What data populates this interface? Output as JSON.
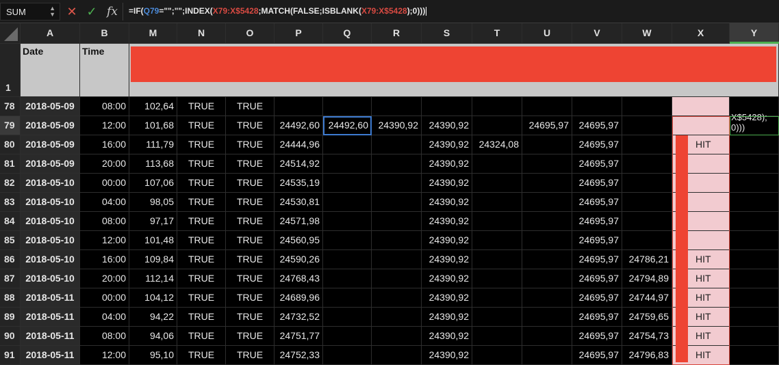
{
  "formula_bar": {
    "name_box": "SUM",
    "cancel_icon": "x-icon",
    "enter_icon": "checkmark-icon",
    "fx_label": "fx",
    "formula_parts": [
      {
        "t": "=IF(",
        "c": ""
      },
      {
        "t": "Q79",
        "c": "blue"
      },
      {
        "t": "=\"\";\"\";INDEX(",
        "c": ""
      },
      {
        "t": "X79:X$5428",
        "c": "red"
      },
      {
        "t": ";MATCH(FALSE;ISBLANK(",
        "c": ""
      },
      {
        "t": "X79:X$5428",
        "c": "red"
      },
      {
        "t": ");0)))",
        "c": ""
      }
    ]
  },
  "columns": [
    "A",
    "B",
    "M",
    "N",
    "O",
    "P",
    "Q",
    "R",
    "S",
    "T",
    "U",
    "V",
    "W",
    "X",
    "Y"
  ],
  "header_row": {
    "row_label": "1",
    "date_label": "Date",
    "time_label": "Time",
    "redacted_color": "#ee4433"
  },
  "rows": [
    {
      "r": "78",
      "date": "2018-05-09",
      "time": "08:00",
      "m": "102,64",
      "n": "TRUE",
      "o": "TRUE",
      "p": "",
      "q": "",
      "rr": "",
      "s": "",
      "t": "",
      "u": "",
      "v": "",
      "w": "",
      "x": ""
    },
    {
      "r": "79",
      "date": "2018-05-09",
      "time": "12:00",
      "m": "101,68",
      "n": "TRUE",
      "o": "TRUE",
      "p": "24492,60",
      "q": "24492,60",
      "rr": "24390,92",
      "s": "24390,92",
      "t": "",
      "u": "24695,97",
      "v": "24695,97",
      "w": "",
      "x": ""
    },
    {
      "r": "80",
      "date": "2018-05-09",
      "time": "16:00",
      "m": "111,79",
      "n": "TRUE",
      "o": "TRUE",
      "p": "24444,96",
      "q": "",
      "rr": "",
      "s": "24390,92",
      "t": "24324,08",
      "u": "",
      "v": "24695,97",
      "w": "",
      "x": "HIT"
    },
    {
      "r": "81",
      "date": "2018-05-09",
      "time": "20:00",
      "m": "113,68",
      "n": "TRUE",
      "o": "TRUE",
      "p": "24514,92",
      "q": "",
      "rr": "",
      "s": "24390,92",
      "t": "",
      "u": "",
      "v": "24695,97",
      "w": "",
      "x": ""
    },
    {
      "r": "82",
      "date": "2018-05-10",
      "time": "00:00",
      "m": "107,06",
      "n": "TRUE",
      "o": "TRUE",
      "p": "24535,19",
      "q": "",
      "rr": "",
      "s": "24390,92",
      "t": "",
      "u": "",
      "v": "24695,97",
      "w": "",
      "x": ""
    },
    {
      "r": "83",
      "date": "2018-05-10",
      "time": "04:00",
      "m": "98,05",
      "n": "TRUE",
      "o": "TRUE",
      "p": "24530,81",
      "q": "",
      "rr": "",
      "s": "24390,92",
      "t": "",
      "u": "",
      "v": "24695,97",
      "w": "",
      "x": ""
    },
    {
      "r": "84",
      "date": "2018-05-10",
      "time": "08:00",
      "m": "97,17",
      "n": "TRUE",
      "o": "TRUE",
      "p": "24571,98",
      "q": "",
      "rr": "",
      "s": "24390,92",
      "t": "",
      "u": "",
      "v": "24695,97",
      "w": "",
      "x": ""
    },
    {
      "r": "85",
      "date": "2018-05-10",
      "time": "12:00",
      "m": "101,48",
      "n": "TRUE",
      "o": "TRUE",
      "p": "24560,95",
      "q": "",
      "rr": "",
      "s": "24390,92",
      "t": "",
      "u": "",
      "v": "24695,97",
      "w": "",
      "x": ""
    },
    {
      "r": "86",
      "date": "2018-05-10",
      "time": "16:00",
      "m": "109,84",
      "n": "TRUE",
      "o": "TRUE",
      "p": "24590,26",
      "q": "",
      "rr": "",
      "s": "24390,92",
      "t": "",
      "u": "",
      "v": "24695,97",
      "w": "24786,21",
      "x": "HIT"
    },
    {
      "r": "87",
      "date": "2018-05-10",
      "time": "20:00",
      "m": "112,14",
      "n": "TRUE",
      "o": "TRUE",
      "p": "24768,43",
      "q": "",
      "rr": "",
      "s": "24390,92",
      "t": "",
      "u": "",
      "v": "24695,97",
      "w": "24794,89",
      "x": "HIT"
    },
    {
      "r": "88",
      "date": "2018-05-11",
      "time": "00:00",
      "m": "104,12",
      "n": "TRUE",
      "o": "TRUE",
      "p": "24689,96",
      "q": "",
      "rr": "",
      "s": "24390,92",
      "t": "",
      "u": "",
      "v": "24695,97",
      "w": "24744,97",
      "x": "HIT"
    },
    {
      "r": "89",
      "date": "2018-05-11",
      "time": "04:00",
      "m": "94,22",
      "n": "TRUE",
      "o": "TRUE",
      "p": "24732,52",
      "q": "",
      "rr": "",
      "s": "24390,92",
      "t": "",
      "u": "",
      "v": "24695,97",
      "w": "24759,65",
      "x": "HIT"
    },
    {
      "r": "90",
      "date": "2018-05-11",
      "time": "08:00",
      "m": "94,06",
      "n": "TRUE",
      "o": "TRUE",
      "p": "24751,77",
      "q": "",
      "rr": "",
      "s": "24390,92",
      "t": "",
      "u": "",
      "v": "24695,97",
      "w": "24754,73",
      "x": "HIT"
    },
    {
      "r": "91",
      "date": "2018-05-11",
      "time": "12:00",
      "m": "95,10",
      "n": "TRUE",
      "o": "TRUE",
      "p": "24752,33",
      "q": "",
      "rr": "",
      "s": "24390,92",
      "t": "",
      "u": "",
      "v": "24695,97",
      "w": "24796,83",
      "x": "HIT"
    }
  ],
  "y79_overflow": [
    "X$5428);",
    "0)))"
  ],
  "colors": {
    "active_cell": "#3d7bd1",
    "x_range_fill": "#f2cbd0",
    "x_range_border": "#d8453c",
    "redaction": "#ee4433",
    "selected_column": "#4caf50"
  }
}
